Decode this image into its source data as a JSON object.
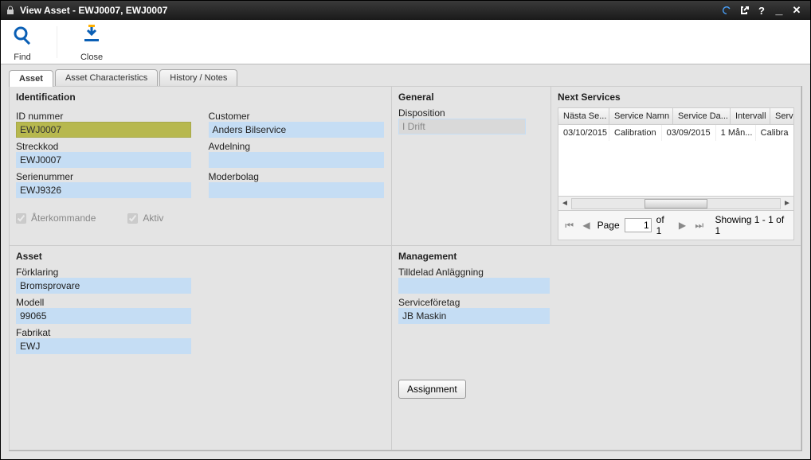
{
  "window": {
    "title": "View Asset - EWJ0007, EWJ0007"
  },
  "toolbar": {
    "find": "Find",
    "close": "Close"
  },
  "tabs": [
    "Asset",
    "Asset Characteristics",
    "History / Notes"
  ],
  "identification": {
    "title": "Identification",
    "id_label": "ID nummer",
    "id_value": "EWJ0007",
    "streck_label": "Streckkod",
    "streck_value": "EWJ0007",
    "serie_label": "Serienummer",
    "serie_value": "EWJ9326",
    "customer_label": "Customer",
    "customer_value": "Anders Bilservice",
    "avd_label": "Avdelning",
    "avd_value": "",
    "moder_label": "Moderbolag",
    "moder_value": "",
    "recurring": "Återkommande",
    "active": "Aktiv"
  },
  "general": {
    "title": "General",
    "disp_label": "Disposition",
    "disp_value": "I Drift"
  },
  "services": {
    "title": "Next Services",
    "headers": [
      "Nästa Se...",
      "Service Namn",
      "Service Da...",
      "Intervall",
      "Servic"
    ],
    "row": [
      "03/10/2015",
      "Calibration",
      "03/09/2015",
      "1 Mån...",
      "Calibra"
    ],
    "page_label": "Page",
    "page_value": "1",
    "of": "of 1",
    "showing": "Showing 1 - 1 of 1"
  },
  "asset": {
    "title": "Asset",
    "fork_label": "Förklaring",
    "fork_value": "Bromsprovare",
    "modell_label": "Modell",
    "modell_value": "99065",
    "fabrikat_label": "Fabrikat",
    "fabrikat_value": "EWJ"
  },
  "mgmt": {
    "title": "Management",
    "till_label": "Tilldelad Anläggning",
    "till_value": "",
    "serv_label": "Serviceföretag",
    "serv_value": "JB Maskin",
    "assign": "Assignment"
  }
}
